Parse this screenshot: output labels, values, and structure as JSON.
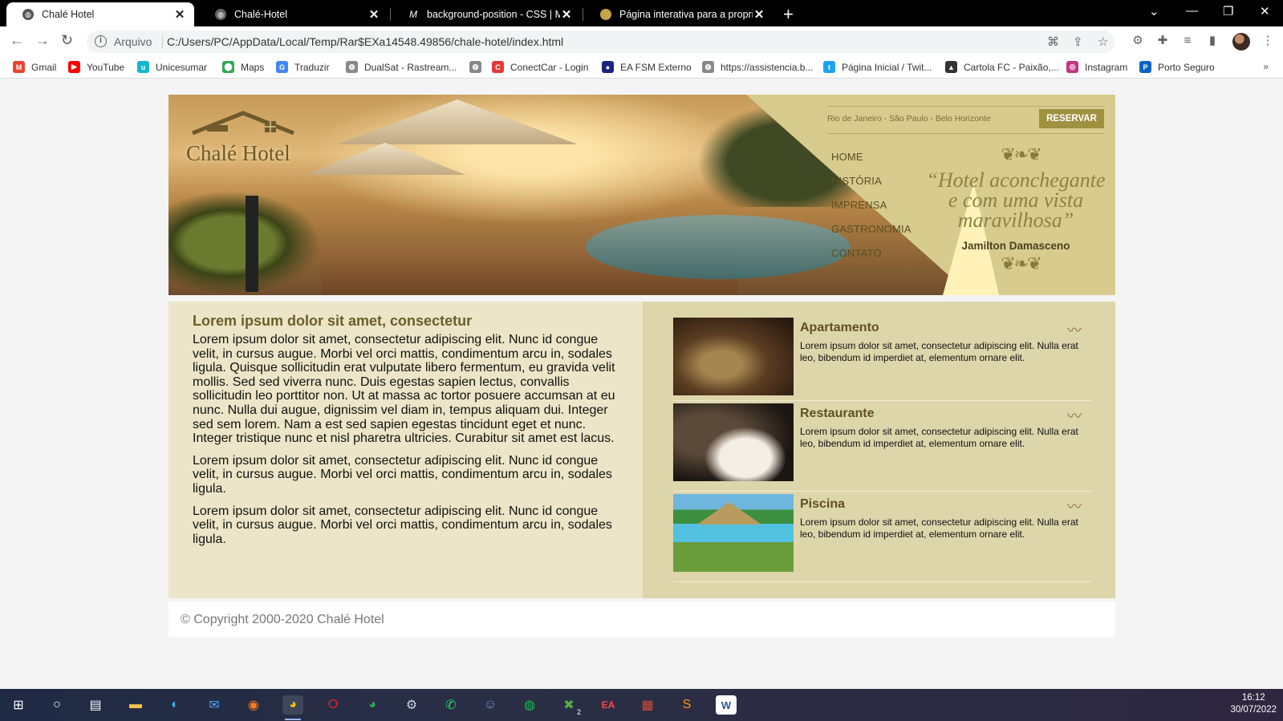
{
  "browser": {
    "tabs": [
      {
        "title": "Chalé Hotel",
        "active": true
      },
      {
        "title": "Chalé-Hotel",
        "active": false
      },
      {
        "title": "background-position - CSS | MDN",
        "active": false
      },
      {
        "title": "Página interativa para a propried",
        "active": false
      }
    ],
    "new_tab_glyph": "+",
    "omnibox": {
      "scheme_label": "Arquivo",
      "url": "C:/Users/PC/AppData/Local/Temp/Rar$EXa14548.49856/chale-hotel/index.html"
    },
    "bookmarks": [
      {
        "label": "Gmail",
        "color": "#ea4335",
        "glyph": "M"
      },
      {
        "label": "YouTube",
        "color": "#ff0000",
        "glyph": "▶"
      },
      {
        "label": "Unicesumar",
        "color": "#12b5cb",
        "glyph": "u"
      },
      {
        "label": "Maps",
        "color": "#34a853",
        "glyph": "⬤"
      },
      {
        "label": "Traduzir",
        "color": "#4285f4",
        "glyph": "G"
      },
      {
        "label": "DualSat - Rastream...",
        "color": "#888888",
        "glyph": "◍"
      },
      {
        "label": "",
        "color": "#888888",
        "glyph": "◍"
      },
      {
        "label": "ConectCar - Login",
        "color": "#e53935",
        "glyph": "C"
      },
      {
        "label": "EA FSM Externo",
        "color": "#1a237e",
        "glyph": "●"
      },
      {
        "label": "https://assistencia.b...",
        "color": "#888888",
        "glyph": "◍"
      },
      {
        "label": "Página Inicial / Twit...",
        "color": "#1da1f2",
        "glyph": "t"
      },
      {
        "label": "Cartola FC - Paixão,...",
        "color": "#333333",
        "glyph": "▲"
      },
      {
        "label": "Instagram",
        "color": "#c13584",
        "glyph": "◎"
      },
      {
        "label": "Porto Seguro",
        "color": "#0a64c8",
        "glyph": "P"
      }
    ],
    "bookmarks_more": "»"
  },
  "site": {
    "logo_text": "Chalé Hotel",
    "cities": "Rio de Janeiro - São Paulo - Belo Horizonte",
    "reserve_label": "RESERVAR",
    "menu": [
      "HOME",
      "HISTÓRIA",
      "IMPRENSA",
      "GASTRONOMIA",
      "CONTATO"
    ],
    "quote": "“Hotel aconchegante e com uma vista maravilhosa”",
    "quote_author": "Jamilton Damasceno",
    "ornament": "❦❧❦",
    "main": {
      "heading": "Lorem ipsum dolor sit amet, consectetur",
      "paragraphs": [
        "Lorem ipsum dolor sit amet, consectetur adipiscing elit. Nunc id congue velit, in cursus augue. Morbi vel orci mattis, condimentum arcu in, sodales ligula. Quisque sollicitudin erat vulputate libero fermentum, eu gravida velit mollis. Sed sed viverra nunc. Duis egestas sapien lectus, convallis sollicitudin leo porttitor non. Ut at massa ac tortor posuere accumsan at eu nunc. Nulla dui augue, dignissim vel diam in, tempus aliquam dui. Integer sed sem lorem. Nam a est sed sapien egestas tincidunt eget et nunc. Integer tristique nunc et nisl pharetra ultricies. Curabitur sit amet est lacus.",
        "Lorem ipsum dolor sit amet, consectetur adipiscing elit. Nunc id congue velit, in cursus augue. Morbi vel orci mattis, condimentum arcu in, sodales ligula.",
        "Lorem ipsum dolor sit amet, consectetur adipiscing elit. Nunc id congue velit, in cursus augue. Morbi vel orci mattis, condimentum arcu in, sodales ligula."
      ]
    },
    "cards": [
      {
        "title": "Apartamento",
        "text": "Lorem ipsum dolor sit amet, consectetur adipiscing elit. Nulla erat leo, bibendum id imperdiet at, elementum ornare elit."
      },
      {
        "title": "Restaurante",
        "text": "Lorem ipsum dolor sit amet, consectetur adipiscing elit. Nulla erat leo, bibendum id imperdiet at, elementum ornare elit."
      },
      {
        "title": "Piscina",
        "text": "Lorem ipsum dolor sit amet, consectetur adipiscing elit. Nulla erat leo, bibendum id imperdiet at, elementum ornare elit."
      }
    ],
    "card_ornament": "〰",
    "footer": "© Copyright 2000-2020 Chalé Hotel"
  },
  "taskbar": {
    "time": "16:12",
    "date": "30/07/2022",
    "xbox_badge": "2"
  },
  "colors": {
    "accent_gold": "#9f9140",
    "header_bg": "#d7cb8e",
    "main_bg": "#ece5c7",
    "aside_bg": "#ddd6ab"
  }
}
